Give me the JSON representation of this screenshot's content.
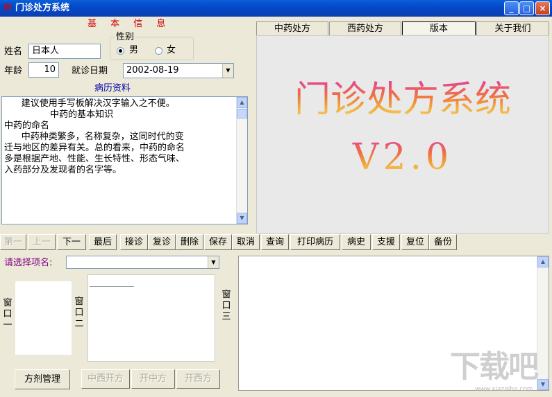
{
  "window": {
    "icon_char": "中",
    "title": "门诊处方系统"
  },
  "basic_info": {
    "header": "基 本 信 息",
    "name_label": "姓名",
    "name_value": "日本人",
    "gender_group": "性别",
    "gender_male": "男",
    "gender_female": "女",
    "gender_selected": "男",
    "age_label": "年龄",
    "age_value": "10",
    "visit_date_label": "就诊日期",
    "visit_date_value": "2002-08-19"
  },
  "records": {
    "header": "病历资料",
    "lines": [
      "      建议使用手写板解决汉字输入之不便。",
      "",
      "                中药的基本知识",
      "",
      "",
      "中药的命名",
      "",
      "      中药种类繁多，名称复杂，这同时代的变",
      "迁与地区的差异有关。总的看来，中药的命名",
      "多是根据产地、性能、生长特性、形态气味、",
      "入药部分及发现者的名字等。"
    ]
  },
  "tabs": [
    "中药处方",
    "西药处方",
    "版本",
    "关于我们"
  ],
  "active_tab": "版本",
  "banner": {
    "title": "门诊处方系统",
    "version": "V2.0"
  },
  "toolbar": [
    {
      "label": "第一",
      "enabled": false
    },
    {
      "label": "上一",
      "enabled": false
    },
    {
      "label": "下一",
      "enabled": true
    },
    {
      "label": "最后",
      "enabled": true
    },
    {
      "label": "接诊",
      "enabled": true
    },
    {
      "label": "复诊",
      "enabled": true
    },
    {
      "label": "删除",
      "enabled": true
    },
    {
      "label": "保存",
      "enabled": true
    },
    {
      "label": "取消",
      "enabled": true
    },
    {
      "label": "查询",
      "enabled": true
    },
    {
      "label": "打印病历",
      "enabled": true
    },
    {
      "label": "病史",
      "enabled": true
    },
    {
      "label": "支援",
      "enabled": true
    },
    {
      "label": "复位",
      "enabled": true
    },
    {
      "label": "备份",
      "enabled": true
    }
  ],
  "lower": {
    "select_label": "请选择项名:",
    "select_value": "",
    "window1_label": "窗口一",
    "window2_label": "窗口二",
    "window3_label": "窗口三",
    "formula_button": "方剂管理",
    "prescription_buttons": [
      "中西开方",
      "开中方",
      "开西方"
    ]
  },
  "watermark": {
    "text": "下载吧",
    "sub": "www.xiazaiba.com"
  },
  "colors": {
    "title_bar": "#0A5FD8",
    "header_red": "#CC0000",
    "header_blue": "#0000AA",
    "label_purple": "#800080"
  }
}
